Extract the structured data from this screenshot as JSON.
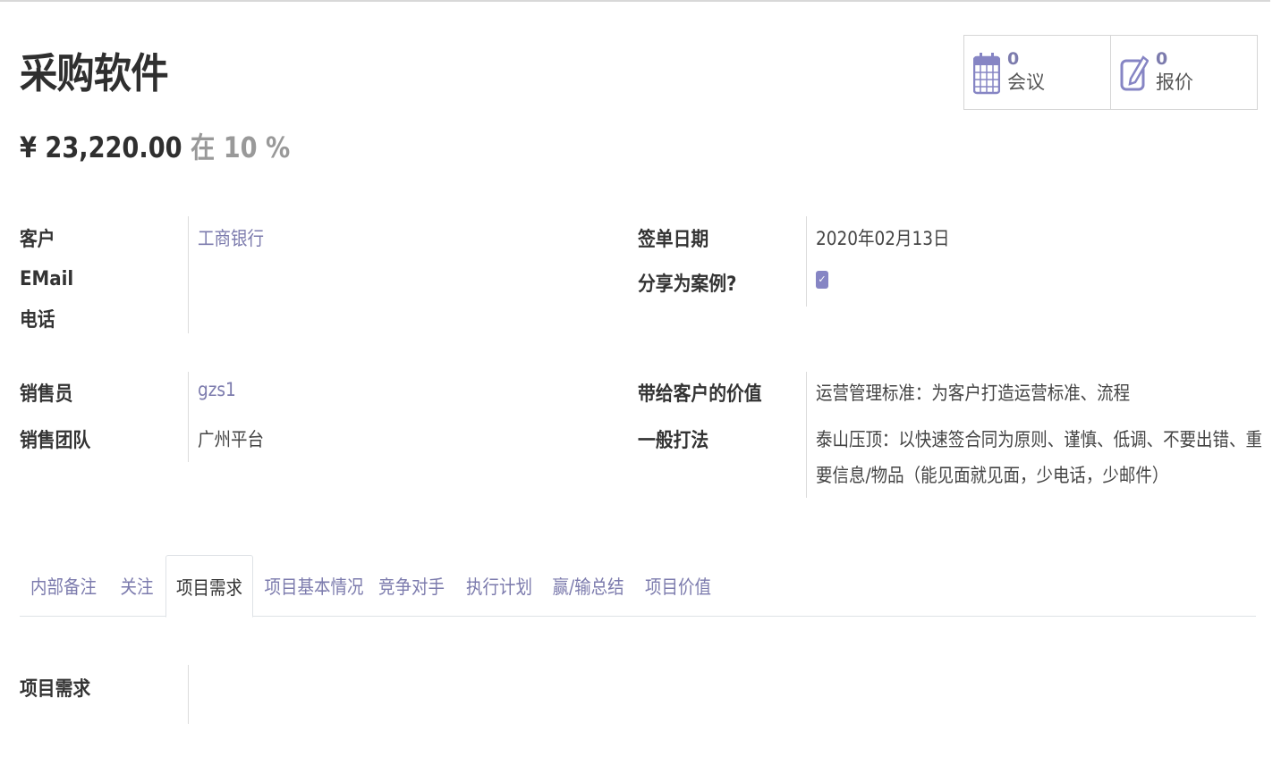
{
  "record": {
    "title": "采购软件",
    "amount": "¥ 23,220.00",
    "at_word": "在",
    "probability": "10 %"
  },
  "smart_buttons": [
    {
      "count": "0",
      "label": "会议",
      "icon": "calendar-icon"
    },
    {
      "count": "0",
      "label": "报价",
      "icon": "pencil-square-icon"
    }
  ],
  "fields": {
    "customer_label": "客户",
    "customer_value": "工商银行",
    "email_label": "EMail",
    "phone_label": "电话",
    "sign_date_label": "签单日期",
    "sign_date_value": "2020年02月13日",
    "share_label": "分享为案例?",
    "share_checked": true,
    "salesperson_label": "销售员",
    "salesperson_value": "gzs1",
    "team_label": "销售团队",
    "team_value": "广州平台",
    "value_label": "带给客户的价值",
    "value_value": "运营管理标准：为客户打造运营标准、流程",
    "approach_label": "一般打法",
    "approach_line1": "泰山压顶：以快速签合同为原则、谨慎、低调、不要出错、重",
    "approach_line2": "要信息/物品（能见面就见面，少电话，少邮件）"
  },
  "tabs": [
    {
      "label": "内部备注",
      "active": false
    },
    {
      "label": "关注",
      "active": false
    },
    {
      "label": "项目需求",
      "active": true
    },
    {
      "label": "项目基本情况",
      "active": false
    },
    {
      "label": "竞争对手",
      "active": false
    },
    {
      "label": "执行计划",
      "active": false
    },
    {
      "label": "赢/输总结",
      "active": false
    },
    {
      "label": "项目价值",
      "active": false
    }
  ],
  "tab_content": {
    "requirement_label": "项目需求"
  },
  "colors": {
    "link": "#7c7bad",
    "checkbox": "#8685c4"
  }
}
